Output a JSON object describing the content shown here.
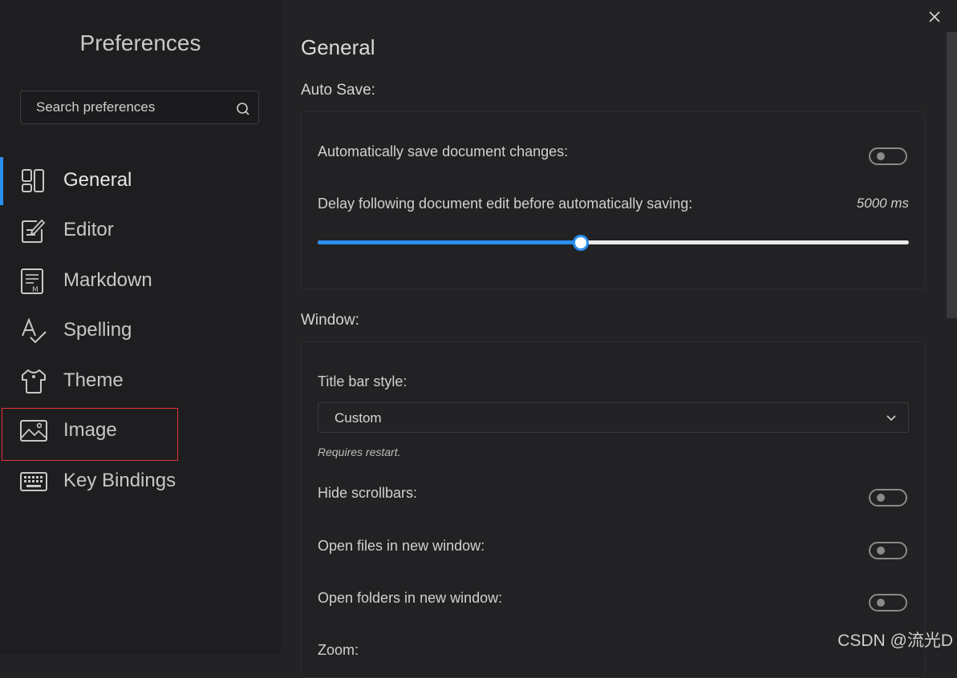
{
  "sidebar": {
    "title": "Preferences",
    "search_placeholder": "Search preferences",
    "items": [
      {
        "label": "General",
        "icon": "general-icon",
        "active": true
      },
      {
        "label": "Editor",
        "icon": "editor-icon"
      },
      {
        "label": "Markdown",
        "icon": "markdown-icon"
      },
      {
        "label": "Spelling",
        "icon": "spelling-icon"
      },
      {
        "label": "Theme",
        "icon": "theme-icon"
      },
      {
        "label": "Image",
        "icon": "image-icon"
      },
      {
        "label": "Key Bindings",
        "icon": "keyboard-icon"
      }
    ]
  },
  "main": {
    "title": "General",
    "auto_save": {
      "section_label": "Auto Save:",
      "auto_save_label": "Automatically save document changes:",
      "auto_save_on": false,
      "delay_label": "Delay following document edit before automatically saving:",
      "delay_value": "5000 ms",
      "delay_fraction": 0.445
    },
    "window": {
      "section_label": "Window:",
      "title_bar_label": "Title bar style:",
      "title_bar_value": "Custom",
      "title_bar_hint": "Requires restart.",
      "hide_scrollbars_label": "Hide scrollbars:",
      "hide_scrollbars_on": false,
      "open_files_label": "Open files in new window:",
      "open_files_on": false,
      "open_folders_label": "Open folders in new window:",
      "open_folders_on": false,
      "zoom_label": "Zoom:"
    }
  },
  "watermark": "CSDN @流光D",
  "colors": {
    "accent": "#2b8ff0",
    "highlight": "#e0353a",
    "sidebar_bg": "#1e1e20",
    "main_bg": "#232325"
  }
}
